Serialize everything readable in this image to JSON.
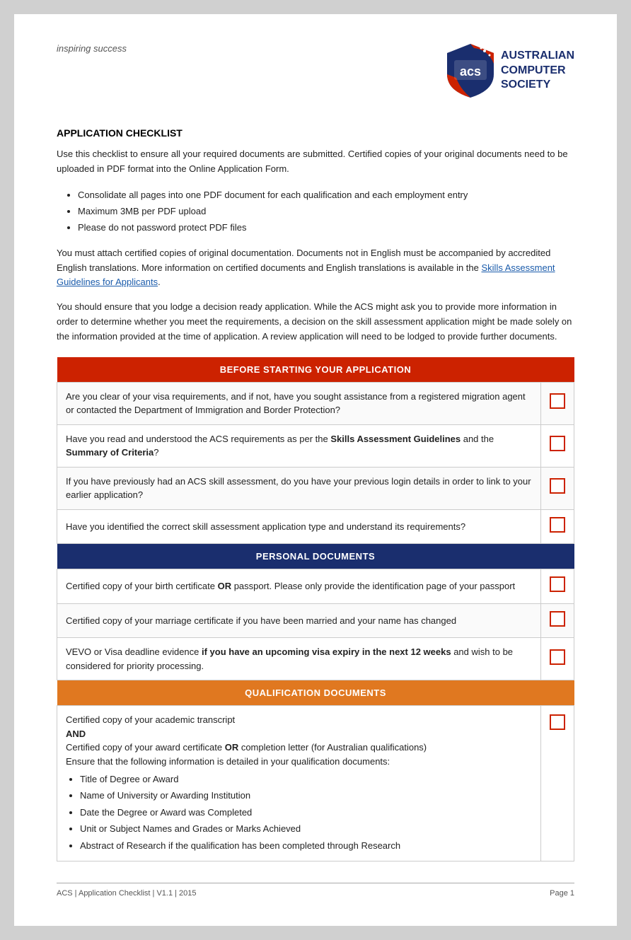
{
  "header": {
    "tagline": "inspiring success",
    "logo_alt": "ACS Australian Computer Society",
    "logo_lines": [
      "AUSTRALIAN",
      "COMPUTER",
      "SOCIETY"
    ]
  },
  "section_title": "APPLICATION CHECKLIST",
  "intro_para1": "Use this checklist to ensure all your required documents are submitted. Certified copies of your original documents need to be uploaded in PDF format into the Online Application Form.",
  "bullet_items": [
    "Consolidate all pages into one PDF document for each qualification and each employment entry",
    "Maximum 3MB per PDF upload",
    "Please do not password protect PDF files"
  ],
  "intro_para2_before_link": "You must attach certified copies of original documentation. Documents not in English must be accompanied by accredited English translations. More information on certified documents and English translations is available in the ",
  "intro_para2_link": "Skills Assessment Guidelines for Applicants",
  "intro_para2_after_link": ".",
  "intro_para3": "You should ensure that you lodge a decision ready application. While the ACS might ask you to provide more information in order to determine whether you meet the requirements, a decision on the skill assessment application might be made solely on the information provided at the time of application. A review application will need to be lodged to provide further documents.",
  "sections": [
    {
      "id": "before-starting",
      "header": "BEFORE STARTING YOUR APPLICATION",
      "color": "red",
      "rows": [
        {
          "text": "Are you clear of your visa requirements, and if not, have you sought assistance from a registered migration agent or contacted the Department of Immigration and Border Protection?"
        },
        {
          "text_parts": [
            {
              "text": "Have you read and understood the ACS requirements as per the ",
              "bold": false
            },
            {
              "text": "Skills Assessment Guidelines",
              "bold": true
            },
            {
              "text": " and the ",
              "bold": false
            },
            {
              "text": "Summary of Criteria",
              "bold": true
            },
            {
              "text": "?",
              "bold": false
            }
          ]
        },
        {
          "text": "If you have previously had an ACS skill assessment, do you have your previous login details in order to link to your earlier application?"
        },
        {
          "text": "Have you identified the correct skill assessment application type and understand its requirements?"
        }
      ]
    },
    {
      "id": "personal-docs",
      "header": "PERSONAL DOCUMENTS",
      "color": "blue",
      "rows": [
        {
          "text_parts": [
            {
              "text": "Certified copy of your birth certificate ",
              "bold": false
            },
            {
              "text": "OR",
              "bold": true
            },
            {
              "text": " passport. Please only provide the identification page of your passport",
              "bold": false
            }
          ]
        },
        {
          "text": "Certified copy of your marriage certificate if you have been married and your name has changed"
        },
        {
          "text_parts": [
            {
              "text": "VEVO or Visa deadline evidence ",
              "bold": false
            },
            {
              "text": "if you have an upcoming visa expiry in the next 12 weeks",
              "bold": true
            },
            {
              "text": " and wish to be considered for priority processing.",
              "bold": false
            }
          ]
        }
      ]
    },
    {
      "id": "qualification-docs",
      "header": "QUALIFICATION DOCUMENTS",
      "color": "orange",
      "rows": [
        {
          "multi_line": true,
          "lines": [
            {
              "text": "Certified copy of your academic transcript",
              "bold": false
            },
            {
              "text": "AND",
              "bold": true
            },
            {
              "text": "Certified copy of your award certificate ",
              "bold": false,
              "inline_bold": "OR",
              "after": " completion letter (for Australian qualifications)"
            },
            {
              "text": "Ensure that the following information is detailed in your qualification documents:",
              "bold": false
            },
            {
              "bullet_items": [
                "Title of Degree or Award",
                "Name of University or Awarding Institution",
                "Date the Degree or Award was Completed",
                "Unit or Subject Names and Grades or Marks Achieved",
                "Abstract of Research if the qualification has been completed through Research"
              ]
            }
          ]
        }
      ]
    }
  ],
  "footer": {
    "left": "ACS | Application Checklist | V1.1 | 2015",
    "right": "Page 1"
  }
}
